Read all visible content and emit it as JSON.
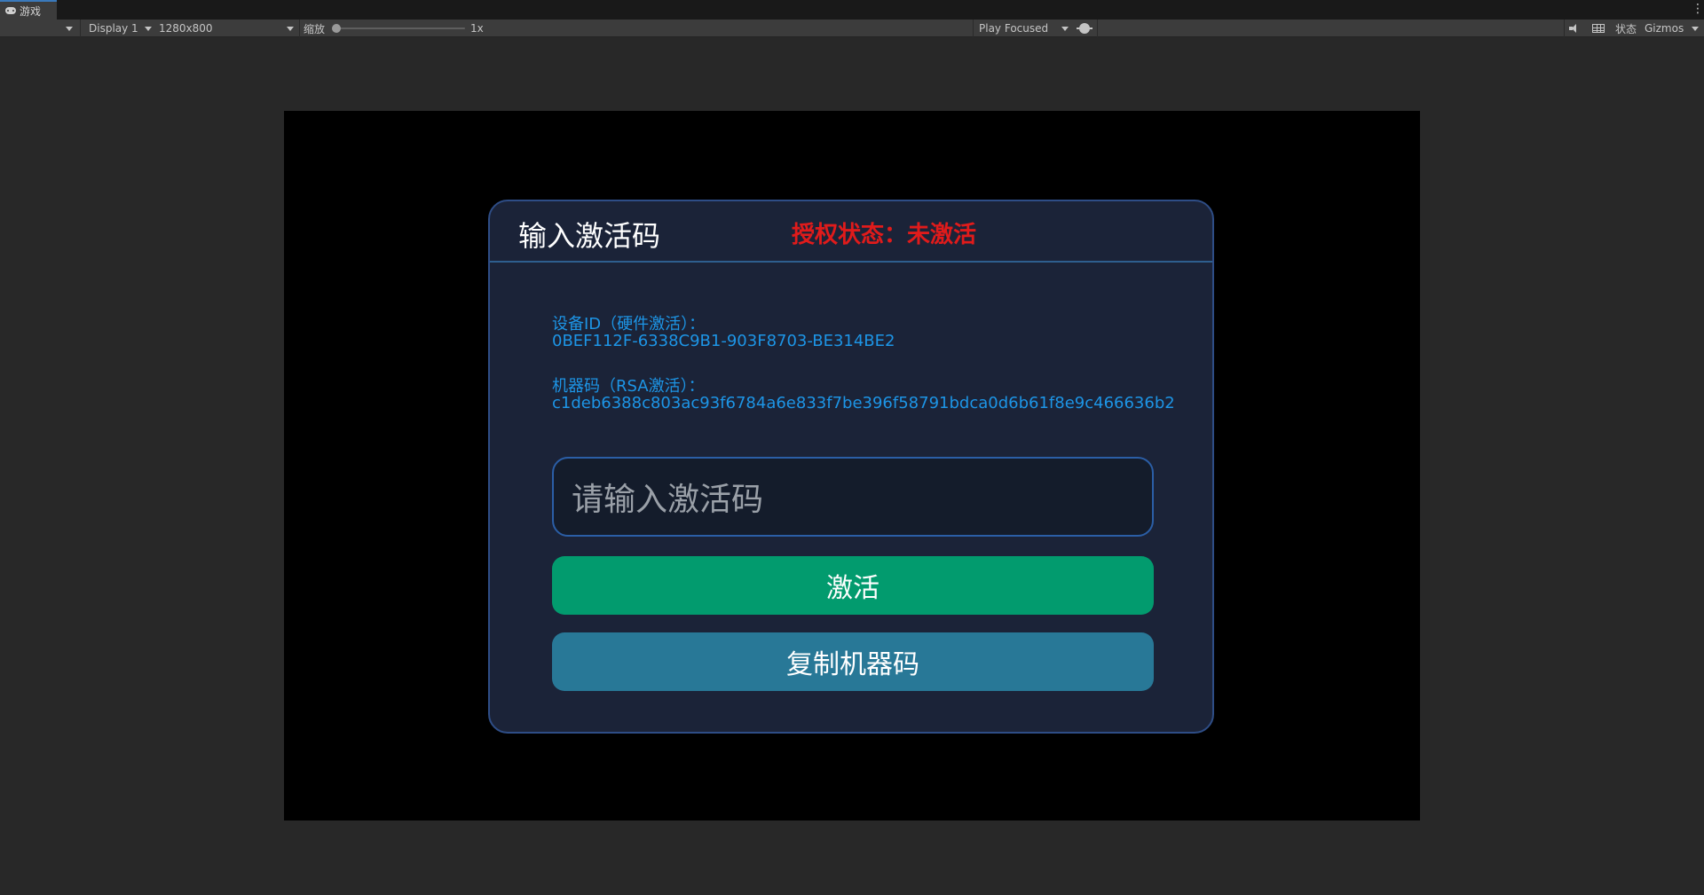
{
  "editor": {
    "tab_label": "游戏",
    "toolbar": {
      "display": "Display 1",
      "resolution": "1280x800",
      "scale_label": "缩放",
      "scale_value": "1x",
      "scale_level": 0,
      "play_mode": "Play Focused",
      "stats": "状态",
      "gizmos": "Gizmos"
    }
  },
  "dialog": {
    "title": "输入激活码",
    "status": "授权状态：未激活",
    "device_id_label": "设备ID（硬件激活）：",
    "device_id_value": "0BEF112F-6338C9B1-903F8703-BE314BE2",
    "machine_code_label": "机器码（RSA激活）：",
    "machine_code_value": "c1deb6388c803ac93f6784a6e833f7be396f58791bdca0d6b61f8e9c466636b2",
    "input_placeholder": "请输入激活码",
    "activate_button": "激活",
    "copy_button": "复制机器码"
  },
  "colors": {
    "status_red": "#e01b1b",
    "info_blue": "#1d95e6",
    "activate_green": "#029b6e",
    "copy_teal": "#287897",
    "dialog_bg": "#1b2338"
  }
}
